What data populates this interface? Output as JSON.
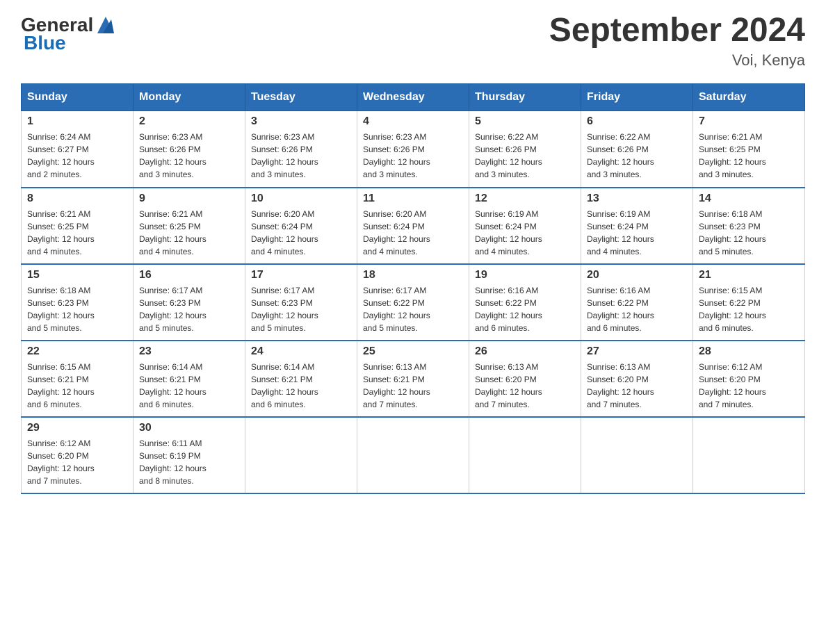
{
  "header": {
    "logo_general": "General",
    "logo_blue": "Blue",
    "title": "September 2024",
    "subtitle": "Voi, Kenya"
  },
  "days_of_week": [
    "Sunday",
    "Monday",
    "Tuesday",
    "Wednesday",
    "Thursday",
    "Friday",
    "Saturday"
  ],
  "weeks": [
    [
      {
        "day": "1",
        "sunrise": "Sunrise: 6:24 AM",
        "sunset": "Sunset: 6:27 PM",
        "daylight": "Daylight: 12 hours and 2 minutes."
      },
      {
        "day": "2",
        "sunrise": "Sunrise: 6:23 AM",
        "sunset": "Sunset: 6:26 PM",
        "daylight": "Daylight: 12 hours and 3 minutes."
      },
      {
        "day": "3",
        "sunrise": "Sunrise: 6:23 AM",
        "sunset": "Sunset: 6:26 PM",
        "daylight": "Daylight: 12 hours and 3 minutes."
      },
      {
        "day": "4",
        "sunrise": "Sunrise: 6:23 AM",
        "sunset": "Sunset: 6:26 PM",
        "daylight": "Daylight: 12 hours and 3 minutes."
      },
      {
        "day": "5",
        "sunrise": "Sunrise: 6:22 AM",
        "sunset": "Sunset: 6:26 PM",
        "daylight": "Daylight: 12 hours and 3 minutes."
      },
      {
        "day": "6",
        "sunrise": "Sunrise: 6:22 AM",
        "sunset": "Sunset: 6:26 PM",
        "daylight": "Daylight: 12 hours and 3 minutes."
      },
      {
        "day": "7",
        "sunrise": "Sunrise: 6:21 AM",
        "sunset": "Sunset: 6:25 PM",
        "daylight": "Daylight: 12 hours and 3 minutes."
      }
    ],
    [
      {
        "day": "8",
        "sunrise": "Sunrise: 6:21 AM",
        "sunset": "Sunset: 6:25 PM",
        "daylight": "Daylight: 12 hours and 4 minutes."
      },
      {
        "day": "9",
        "sunrise": "Sunrise: 6:21 AM",
        "sunset": "Sunset: 6:25 PM",
        "daylight": "Daylight: 12 hours and 4 minutes."
      },
      {
        "day": "10",
        "sunrise": "Sunrise: 6:20 AM",
        "sunset": "Sunset: 6:24 PM",
        "daylight": "Daylight: 12 hours and 4 minutes."
      },
      {
        "day": "11",
        "sunrise": "Sunrise: 6:20 AM",
        "sunset": "Sunset: 6:24 PM",
        "daylight": "Daylight: 12 hours and 4 minutes."
      },
      {
        "day": "12",
        "sunrise": "Sunrise: 6:19 AM",
        "sunset": "Sunset: 6:24 PM",
        "daylight": "Daylight: 12 hours and 4 minutes."
      },
      {
        "day": "13",
        "sunrise": "Sunrise: 6:19 AM",
        "sunset": "Sunset: 6:24 PM",
        "daylight": "Daylight: 12 hours and 4 minutes."
      },
      {
        "day": "14",
        "sunrise": "Sunrise: 6:18 AM",
        "sunset": "Sunset: 6:23 PM",
        "daylight": "Daylight: 12 hours and 5 minutes."
      }
    ],
    [
      {
        "day": "15",
        "sunrise": "Sunrise: 6:18 AM",
        "sunset": "Sunset: 6:23 PM",
        "daylight": "Daylight: 12 hours and 5 minutes."
      },
      {
        "day": "16",
        "sunrise": "Sunrise: 6:17 AM",
        "sunset": "Sunset: 6:23 PM",
        "daylight": "Daylight: 12 hours and 5 minutes."
      },
      {
        "day": "17",
        "sunrise": "Sunrise: 6:17 AM",
        "sunset": "Sunset: 6:23 PM",
        "daylight": "Daylight: 12 hours and 5 minutes."
      },
      {
        "day": "18",
        "sunrise": "Sunrise: 6:17 AM",
        "sunset": "Sunset: 6:22 PM",
        "daylight": "Daylight: 12 hours and 5 minutes."
      },
      {
        "day": "19",
        "sunrise": "Sunrise: 6:16 AM",
        "sunset": "Sunset: 6:22 PM",
        "daylight": "Daylight: 12 hours and 6 minutes."
      },
      {
        "day": "20",
        "sunrise": "Sunrise: 6:16 AM",
        "sunset": "Sunset: 6:22 PM",
        "daylight": "Daylight: 12 hours and 6 minutes."
      },
      {
        "day": "21",
        "sunrise": "Sunrise: 6:15 AM",
        "sunset": "Sunset: 6:22 PM",
        "daylight": "Daylight: 12 hours and 6 minutes."
      }
    ],
    [
      {
        "day": "22",
        "sunrise": "Sunrise: 6:15 AM",
        "sunset": "Sunset: 6:21 PM",
        "daylight": "Daylight: 12 hours and 6 minutes."
      },
      {
        "day": "23",
        "sunrise": "Sunrise: 6:14 AM",
        "sunset": "Sunset: 6:21 PM",
        "daylight": "Daylight: 12 hours and 6 minutes."
      },
      {
        "day": "24",
        "sunrise": "Sunrise: 6:14 AM",
        "sunset": "Sunset: 6:21 PM",
        "daylight": "Daylight: 12 hours and 6 minutes."
      },
      {
        "day": "25",
        "sunrise": "Sunrise: 6:13 AM",
        "sunset": "Sunset: 6:21 PM",
        "daylight": "Daylight: 12 hours and 7 minutes."
      },
      {
        "day": "26",
        "sunrise": "Sunrise: 6:13 AM",
        "sunset": "Sunset: 6:20 PM",
        "daylight": "Daylight: 12 hours and 7 minutes."
      },
      {
        "day": "27",
        "sunrise": "Sunrise: 6:13 AM",
        "sunset": "Sunset: 6:20 PM",
        "daylight": "Daylight: 12 hours and 7 minutes."
      },
      {
        "day": "28",
        "sunrise": "Sunrise: 6:12 AM",
        "sunset": "Sunset: 6:20 PM",
        "daylight": "Daylight: 12 hours and 7 minutes."
      }
    ],
    [
      {
        "day": "29",
        "sunrise": "Sunrise: 6:12 AM",
        "sunset": "Sunset: 6:20 PM",
        "daylight": "Daylight: 12 hours and 7 minutes."
      },
      {
        "day": "30",
        "sunrise": "Sunrise: 6:11 AM",
        "sunset": "Sunset: 6:19 PM",
        "daylight": "Daylight: 12 hours and 8 minutes."
      },
      null,
      null,
      null,
      null,
      null
    ]
  ]
}
